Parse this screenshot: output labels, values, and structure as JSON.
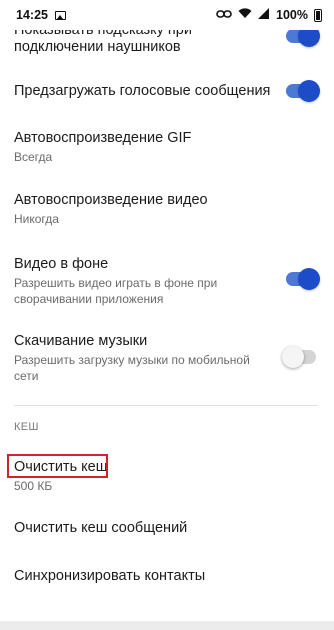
{
  "status_bar": {
    "time": "14:25",
    "battery": "100%"
  },
  "settings": {
    "headphones_hint": {
      "title_line1": "Показывать подсказку при",
      "title_line2": "подключении наушников",
      "enabled": true
    },
    "preload_voice": {
      "title": "Предзагружать голосовые сообщения",
      "enabled": true
    },
    "autoplay_gif": {
      "title": "Автовоспроизведение GIF",
      "value": "Всегда"
    },
    "autoplay_video": {
      "title": "Автовоспроизведение видео",
      "value": "Никогда"
    },
    "background_video": {
      "title": "Видео в фоне",
      "description_line1": "Разрешить видео играть в фоне при",
      "description_line2": "сворачивании приложения",
      "enabled": true
    },
    "music_download": {
      "title": "Скачивание музыки",
      "description_line1": "Разрешить загрузку музыки по мобильной",
      "description_line2": "сети",
      "enabled": false
    }
  },
  "cache_section": {
    "header": "КЕШ",
    "clear_cache": {
      "title": "Очистить кеш",
      "size": "500 КБ"
    },
    "clear_message_cache": {
      "title": "Очистить кеш сообщений"
    },
    "sync_contacts": {
      "title": "Синхронизировать контакты"
    }
  },
  "colors": {
    "toggle_on_thumb": "#1d4cc9",
    "toggle_on_track": "#4d79d6",
    "highlight": "#d2232a"
  },
  "icons": [
    "gallery-icon",
    "link-icon",
    "wifi-icon",
    "signal-icon",
    "battery-icon"
  ]
}
